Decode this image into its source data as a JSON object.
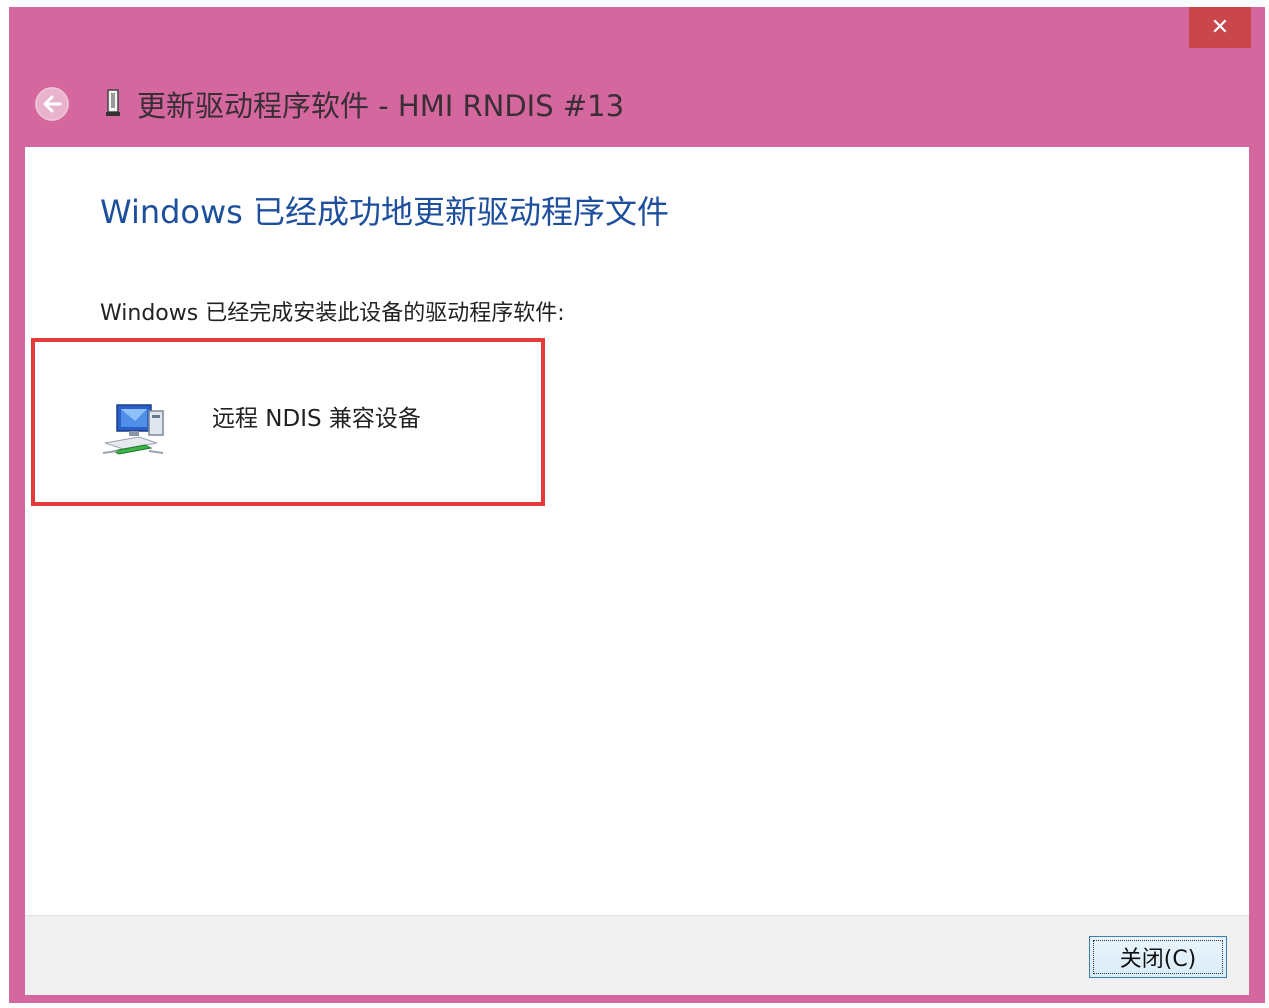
{
  "window": {
    "title": "更新驱动程序软件 - HMI RNDIS #13",
    "close_glyph": "✕",
    "frame_color": "#d5679f"
  },
  "content": {
    "heading": "Windows 已经成功地更新驱动程序文件",
    "description": "Windows 已经完成安装此设备的驱动程序软件:",
    "device": {
      "name": "远程 NDIS 兼容设备",
      "icon": "network-adapter-icon"
    }
  },
  "footer": {
    "close_button_label": "关闭(C)"
  },
  "colors": {
    "heading": "#1e4f9c",
    "highlight_border": "#e53a3a",
    "close_x_bg": "#c9474a"
  }
}
